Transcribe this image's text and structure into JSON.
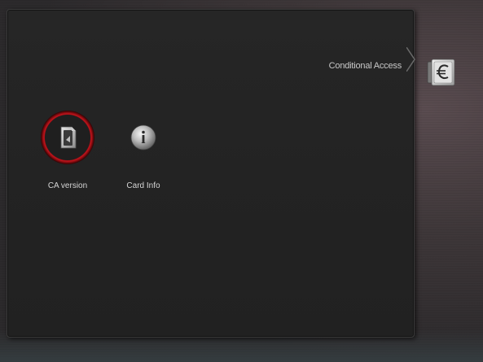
{
  "header": {
    "title": "Conditional Access",
    "category_icon": "euro-card-icon"
  },
  "menu": {
    "items": [
      {
        "label": "CA version",
        "icon": "ca-version-icon",
        "selected": true
      },
      {
        "label": "Card Info",
        "icon": "card-info-icon",
        "selected": false
      }
    ]
  },
  "colors": {
    "selection_ring": "#c0141c",
    "panel": "#232323",
    "text": "#d6d6d6"
  }
}
